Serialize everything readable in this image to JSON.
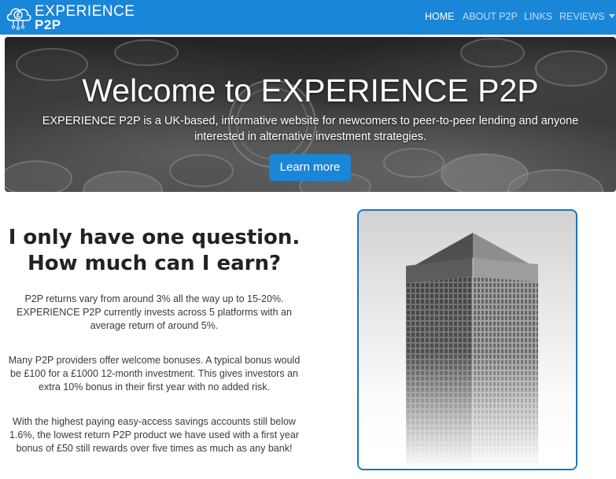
{
  "brand": {
    "line1": "EXPERIENCE",
    "line2": "P2P",
    "icon": "cloud-pound-circuit-icon"
  },
  "nav": {
    "items": [
      {
        "label": "HOME",
        "active": true
      },
      {
        "label": "ABOUT P2P",
        "active": false
      },
      {
        "label": "LINKS",
        "active": false
      },
      {
        "label": "REVIEWS",
        "active": false,
        "dropdown": true
      }
    ]
  },
  "hero": {
    "title": "Welcome to EXPERIENCE P2P",
    "subtitle": "EXPERIENCE P2P is a UK-based, informative website for newcomers to peer-to-peer lending and anyone interested in alternative investment strategies.",
    "button": "Learn more"
  },
  "main": {
    "heading_line1": "I only have one question.",
    "heading_line2": "How much can I earn?",
    "paragraphs": [
      "P2P returns vary from around 3% all the way up to 15-20%. EXPERIENCE P2P currently invests across 5 platforms with an average return of around 5%.",
      "Many P2P providers offer welcome bonuses. A typical bonus would be £100 for a £1000 12-month investment. This gives investors an extra 10% bonus in their first year with no added risk.",
      "With the highest paying easy-access savings accounts still below 1.6%, the lowest return P2P product we have used with a first year bonus of £50 still rewards over five times as much as any bank!"
    ]
  },
  "colors": {
    "navbar": "#1a86d8",
    "button": "#1a86d8",
    "frame_border": "#1a76c0"
  }
}
